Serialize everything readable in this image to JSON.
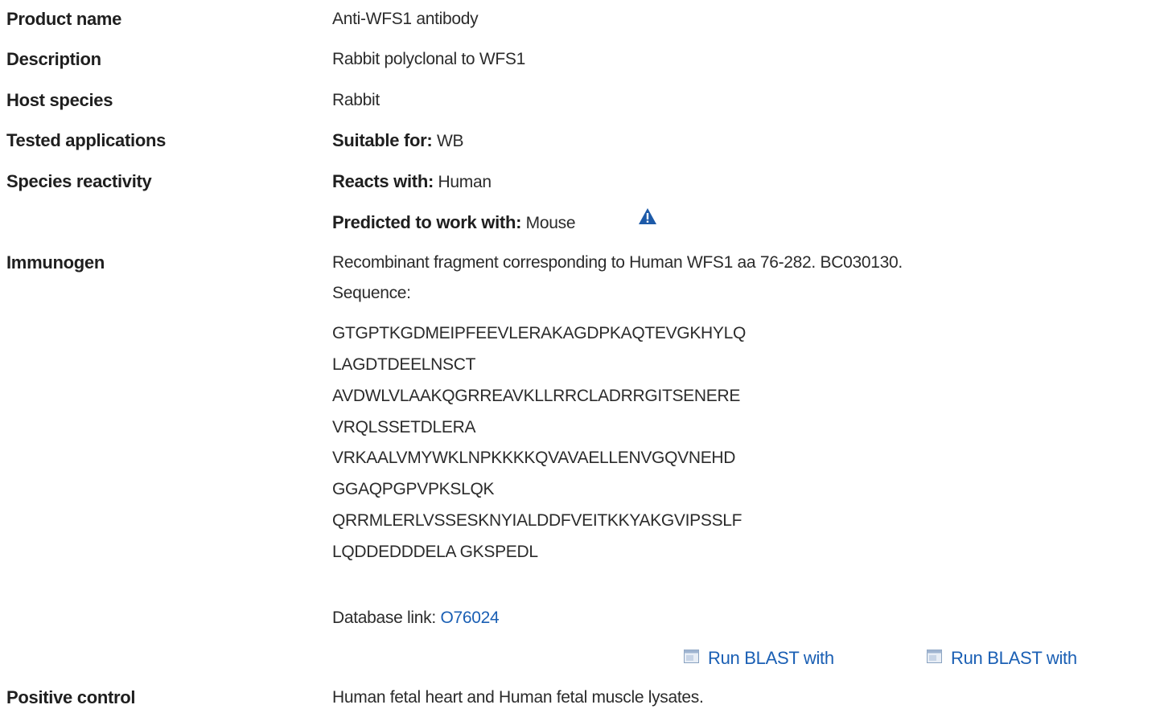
{
  "rows": {
    "product_name": {
      "label": "Product name",
      "value": "Anti-WFS1 antibody"
    },
    "description": {
      "label": "Description",
      "value": "Rabbit polyclonal to WFS1"
    },
    "host_species": {
      "label": "Host species",
      "value": "Rabbit"
    },
    "tested_applications": {
      "label": "Tested applications",
      "prefix": "Suitable for:",
      "value": "WB"
    },
    "species_reactivity": {
      "label": "Species reactivity",
      "reacts_prefix": "Reacts with:",
      "reacts_value": "Human",
      "predicted_prefix": "Predicted to work with:",
      "predicted_value": "Mouse",
      "warning_icon": "warning-triangle-icon"
    },
    "immunogen": {
      "label": "Immunogen",
      "description": "Recombinant fragment corresponding to Human WFS1 aa 76-282. BC030130.",
      "sequence_label": "Sequence:",
      "sequence_lines": [
        "GTGPTKGDMEIPFEEVLERAKAGDPKAQTEVGKHYLQ",
        "LAGDTDEELNSCT",
        "AVDWLVLAAKQGRREAVKLLRRCLADRRGITSENERE",
        "VRQLSSETDLERA",
        "VRKAALVMYWKLNPKKKKQVAVAELLENVGQVNEHD",
        "GGAQPGPVPKSLQK",
        "QRRMLERLVSSESKNYIALDDFVEITKKYAKGVIPSSLF",
        "LQDDEDDDELA GKSPEDL"
      ],
      "database_link_label": "Database link:",
      "database_link_value": "O76024",
      "blast_links": [
        "Run BLAST with",
        "Run BLAST with"
      ]
    },
    "positive_control": {
      "label": "Positive control",
      "value": "Human fetal heart and Human fetal muscle lysates."
    }
  },
  "colors": {
    "link": "#1a5fb4",
    "warning_icon": "#1d5aa8",
    "text": "#2b2b2b",
    "label": "#1f1f1f"
  }
}
